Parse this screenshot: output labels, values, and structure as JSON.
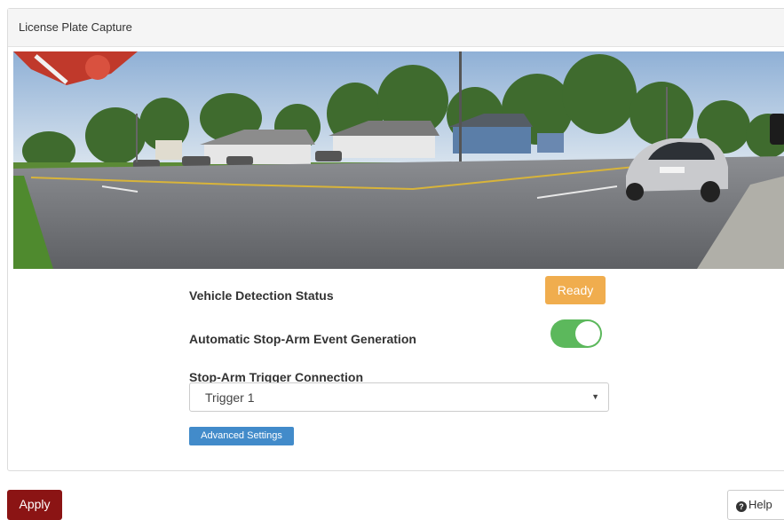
{
  "panel": {
    "title": "License Plate Capture",
    "camera_image": "panoramic-road-camera-view"
  },
  "detection": {
    "label": "Vehicle Detection Status",
    "status": "Ready",
    "status_color": "#f0ad4e"
  },
  "auto_stop_arm": {
    "label": "Automatic Stop-Arm Event Generation",
    "enabled": true,
    "toggle_color": "#5cb85c"
  },
  "trigger": {
    "label": "Stop-Arm Trigger Connection",
    "selected": "Trigger 1"
  },
  "advanced": {
    "label": "Advanced Settings"
  },
  "footer": {
    "apply_label": "Apply",
    "apply_color": "#8b1414",
    "help_label": "Help",
    "help_icon": "question-circle-icon"
  }
}
